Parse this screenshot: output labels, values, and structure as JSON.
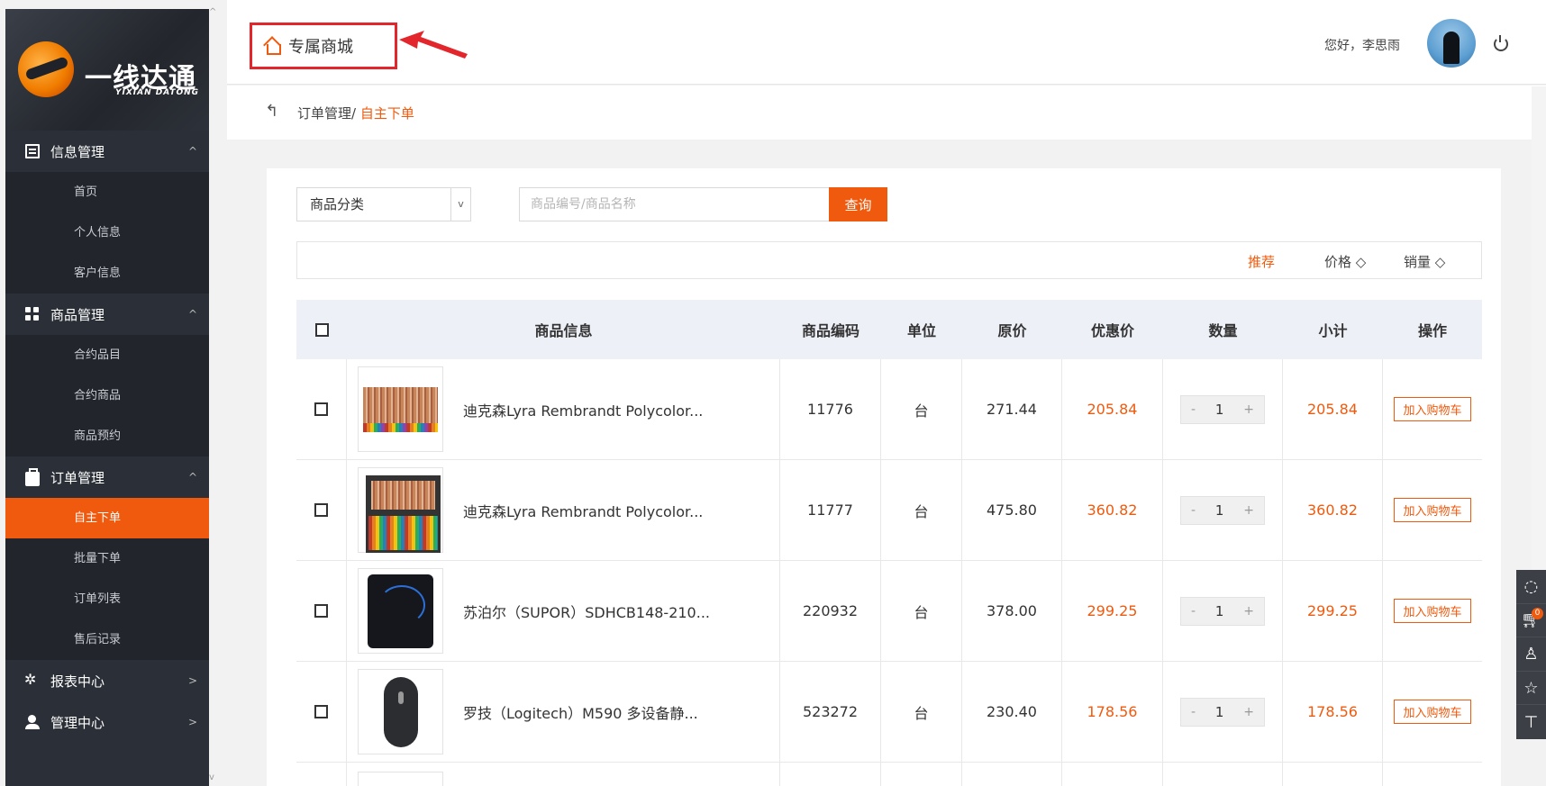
{
  "brand": {
    "cn": "一线达通",
    "en": "YIXIAN DATONG"
  },
  "sidebar": {
    "groups": [
      {
        "label": "信息管理",
        "arrow": "^",
        "items": [
          "首页",
          "个人信息",
          "客户信息"
        ]
      },
      {
        "label": "商品管理",
        "arrow": "^",
        "items": [
          "合约品目",
          "合约商品",
          "商品预约"
        ]
      },
      {
        "label": "订单管理",
        "arrow": "^",
        "items": [
          "自主下单",
          "批量下单",
          "订单列表",
          "售后记录"
        ]
      },
      {
        "label": "报表中心",
        "arrow": ">",
        "items": []
      },
      {
        "label": "管理中心",
        "arrow": ">",
        "items": []
      }
    ],
    "active_item": "自主下单"
  },
  "header": {
    "home_label": "专属商城",
    "greeting": "您好，李思雨"
  },
  "breadcrumb": {
    "parent": "订单管理",
    "separator": "/ ",
    "current": "自主下单"
  },
  "filters": {
    "category_select": "商品分类",
    "search_placeholder": "商品编号/商品名称",
    "query_button": "查询"
  },
  "sort": {
    "recommend": "推荐",
    "price": "价格 ◇",
    "sales": "销量 ◇"
  },
  "table": {
    "columns": [
      "商品信息",
      "商品编码",
      "单位",
      "原价",
      "优惠价",
      "数量",
      "小计",
      "操作"
    ],
    "qty_minus": "-",
    "qty_plus": "+",
    "add_cart_label": "加入购物车",
    "rows": [
      {
        "name": "迪克森Lyra Rembrandt Polycolor...",
        "code": "11776",
        "unit": "台",
        "orig": "271.44",
        "disc": "205.84",
        "qty": "1",
        "subtotal": "205.84",
        "thumb": "pencils1"
      },
      {
        "name": "迪克森Lyra Rembrandt Polycolor...",
        "code": "11777",
        "unit": "台",
        "orig": "475.80",
        "disc": "360.82",
        "qty": "1",
        "subtotal": "360.82",
        "thumb": "pencils2"
      },
      {
        "name": "苏泊尔（SUPOR）SDHCB148-210...",
        "code": "220932",
        "unit": "台",
        "orig": "378.00",
        "disc": "299.25",
        "qty": "1",
        "subtotal": "299.25",
        "thumb": "cooker"
      },
      {
        "name": "罗技（Logitech）M590 多设备静...",
        "code": "523272",
        "unit": "台",
        "orig": "230.40",
        "disc": "178.56",
        "qty": "1",
        "subtotal": "178.56",
        "thumb": "mouse"
      }
    ]
  },
  "float_toolbar": {
    "cart_count": "0"
  },
  "colors": {
    "accent": "#ef5a0e",
    "sidebar_bg": "#2b2f37",
    "highlight_box": "#e2262b"
  }
}
